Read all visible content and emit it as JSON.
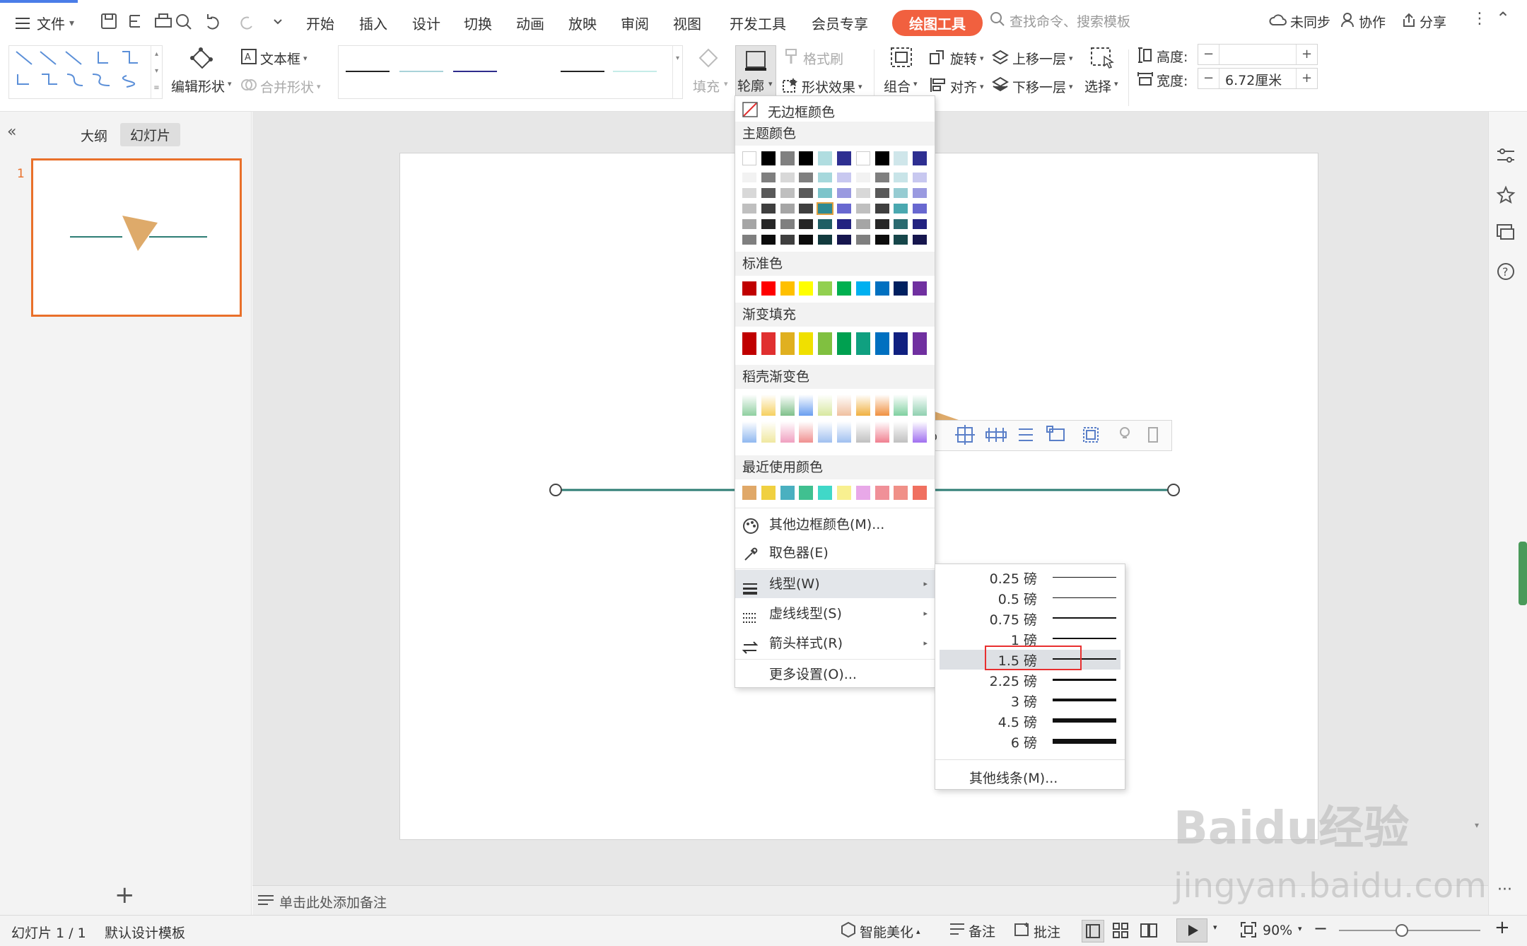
{
  "menubar": {
    "file_label": "文件",
    "tabs": [
      "开始",
      "插入",
      "设计",
      "切换",
      "动画",
      "放映",
      "审阅",
      "视图",
      "开发工具",
      "会员专享"
    ],
    "active_tab": "绘图工具",
    "search_placeholder": "查找命令、搜索模板",
    "sync_label": "未同步",
    "collab_label": "协作",
    "share_label": "分享"
  },
  "ribbon": {
    "edit_shape": "编辑形状",
    "textbox": "文本框",
    "merge_shape": "合并形状",
    "fill": "填充",
    "outline": "轮廓",
    "format_painter": "格式刷",
    "shape_effect": "形状效果",
    "group": "组合",
    "rotate": "旋转",
    "align": "对齐",
    "bring_forward": "上移一层",
    "send_backward": "下移一层",
    "select": "选择",
    "height_label": "高度:",
    "height_value": "",
    "width_label": "宽度:",
    "width_value": "6.72厘米",
    "line_style_colors": [
      "#222222",
      "#a9d3d9",
      "#2e2c8c",
      "#ffffff",
      "#222222",
      "#c5ece8"
    ]
  },
  "leftpanel": {
    "tab_outline": "大纲",
    "tab_slides": "幻灯片",
    "slide_number": "1"
  },
  "notes": {
    "placeholder": "单击此处添加备注"
  },
  "outline_menu": {
    "no_border": "无边框颜色",
    "theme_colors": "主题颜色",
    "standard_colors": "标准色",
    "gradient_fill": "渐变填充",
    "docer_gradient": "稻壳渐变色",
    "recent_colors": "最近使用颜色",
    "more_colors": "其他边框颜色(M)...",
    "eyedropper": "取色器(E)",
    "line_type": "线型(W)",
    "dash_type": "虚线线型(S)",
    "arrow_style": "箭头样式(R)",
    "more_settings": "更多设置(O)...",
    "theme_top": [
      "#ffffff",
      "#000000",
      "#808080",
      "#000000",
      "#b0dde0",
      "#2e2f91",
      "#ffffff",
      "#000000",
      "#cfe6ea",
      "#2e2f91"
    ],
    "standard": [
      "#c00000",
      "#ff0000",
      "#ffc000",
      "#ffff00",
      "#92d050",
      "#00b050",
      "#00b0f0",
      "#0070c0",
      "#002060",
      "#7030a0"
    ],
    "gradient": [
      "#c00000",
      "#e03030",
      "#e0b020",
      "#f0e000",
      "#80c040",
      "#00a050",
      "#10a080",
      "#0070c0",
      "#102080",
      "#7030a0"
    ],
    "recent": [
      "#e0a868",
      "#f0d040",
      "#4ab0c0",
      "#40c090",
      "#40d8c8",
      "#f8f090",
      "#e8a8e8",
      "#f09098",
      "#f09088",
      "#f07060"
    ]
  },
  "line_weights": {
    "items": [
      "0.25 磅",
      "0.5 磅",
      "0.75 磅",
      "1 磅",
      "1.5 磅",
      "2.25 磅",
      "3 磅",
      "4.5 磅",
      "6 磅"
    ],
    "selected": "1.5 磅",
    "more": "其他线条(M)..."
  },
  "status": {
    "slide_info": "幻灯片 1 / 1",
    "template": "默认设计模板",
    "smart_beautify": "智能美化",
    "notes": "备注",
    "comments": "批注",
    "zoom": "90%"
  },
  "watermark": {
    "line1": "Baidu经验",
    "line2": "jingyan.baidu.com"
  },
  "slide": {
    "line_color": "#2e7d74",
    "triangle_color": "#deaa6a"
  }
}
